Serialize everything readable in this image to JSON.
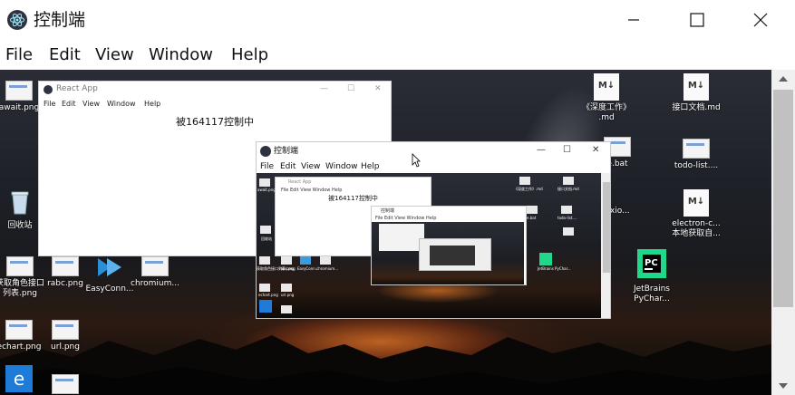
{
  "window": {
    "title": "控制端",
    "minimize_glyph": "—",
    "maximize_glyph": "☐",
    "close_glyph": "✕"
  },
  "menu": [
    "File",
    "Edit",
    "View",
    "Window",
    "Help"
  ],
  "desktop_icons": [
    {
      "label": "await.png"
    },
    {
      "label": "回收站"
    },
    {
      "label": "获取角色接口\n列表.png"
    },
    {
      "label": "rabc.png"
    },
    {
      "label": "EasyConn..."
    },
    {
      "label": "chromium..."
    },
    {
      "label": "echart.png"
    },
    {
      "label": "url.png"
    },
    {
      "label": "《深度工作》\n.md"
    },
    {
      "label": "接口文档.md"
    },
    {
      "label": "e.bat"
    },
    {
      "label": "todo-list...."
    },
    {
      "label": "axio..."
    },
    {
      "label": "electron-c...\n本地获取自..."
    },
    {
      "label": "JetBrains\nPyChar..."
    }
  ],
  "react_window": {
    "title": "React App",
    "menu": [
      "File",
      "Edit",
      "View",
      "Window",
      "Help"
    ],
    "content": "被164117控制中",
    "ctrl_min": "—",
    "ctrl_max": "☐",
    "ctrl_close": "✕"
  },
  "nested_control_window": {
    "title": "控制端",
    "menu": [
      "File",
      "Edit",
      "View",
      "Window",
      "Help"
    ],
    "ctrl_min": "—",
    "ctrl_max": "☐",
    "ctrl_close": "✕",
    "inner_react_title": "React App",
    "inner_react_menu": "File  Edit  View  Window  Help",
    "inner_react_content": "被164117控制中",
    "inner_ctrl_title": "控制端",
    "inner_ctrl_menu": "File  Edit  View  Window  Help"
  },
  "nested_labels": {
    "a": "await.png",
    "b": "回收站",
    "c": "获取角色接口列表.png",
    "d": "rabc.png",
    "e": "EasyConn...",
    "f": "chromium...",
    "g": "echart.png",
    "h": "url.png",
    "i": "《深度工作》.md",
    "j": "接口文档.md",
    "k": "e.bat",
    "l": "todo-list....",
    "m": "JetBrains PyChar..."
  },
  "colors": {
    "electron_logo_bg": "#2f3241",
    "scrollbar_track": "#f0f0f0",
    "scrollbar_thumb": "#c1c1c1",
    "jetbrains_green": "#21d789"
  }
}
